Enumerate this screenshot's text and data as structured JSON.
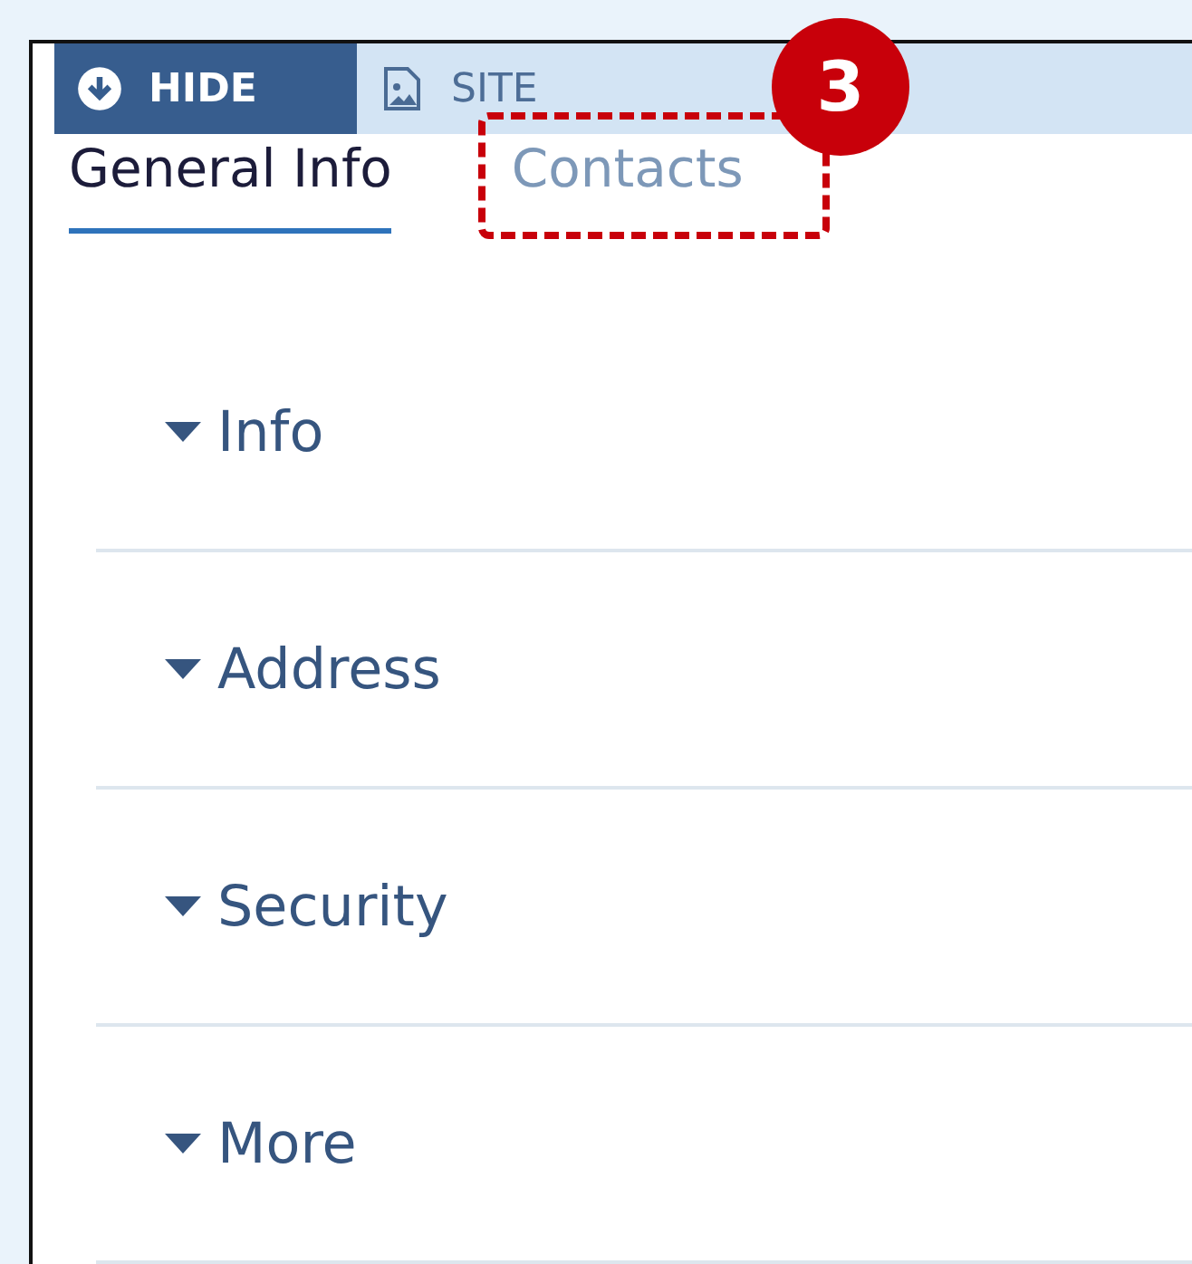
{
  "toolbar": {
    "buttons": [
      {
        "label": "HIDE",
        "kind": "hide",
        "selected": true
      },
      {
        "label": "SITE",
        "kind": "image",
        "selected": false
      }
    ]
  },
  "tabs": [
    {
      "label": "General Info",
      "selected": true
    },
    {
      "label": "Contacts",
      "selected": false
    }
  ],
  "callout": {
    "number": "3"
  },
  "sections": [
    {
      "title": "Info",
      "expanded": true
    },
    {
      "title": "Address",
      "expanded": true
    },
    {
      "title": "Security",
      "expanded": true
    },
    {
      "title": "More",
      "expanded": true
    }
  ]
}
